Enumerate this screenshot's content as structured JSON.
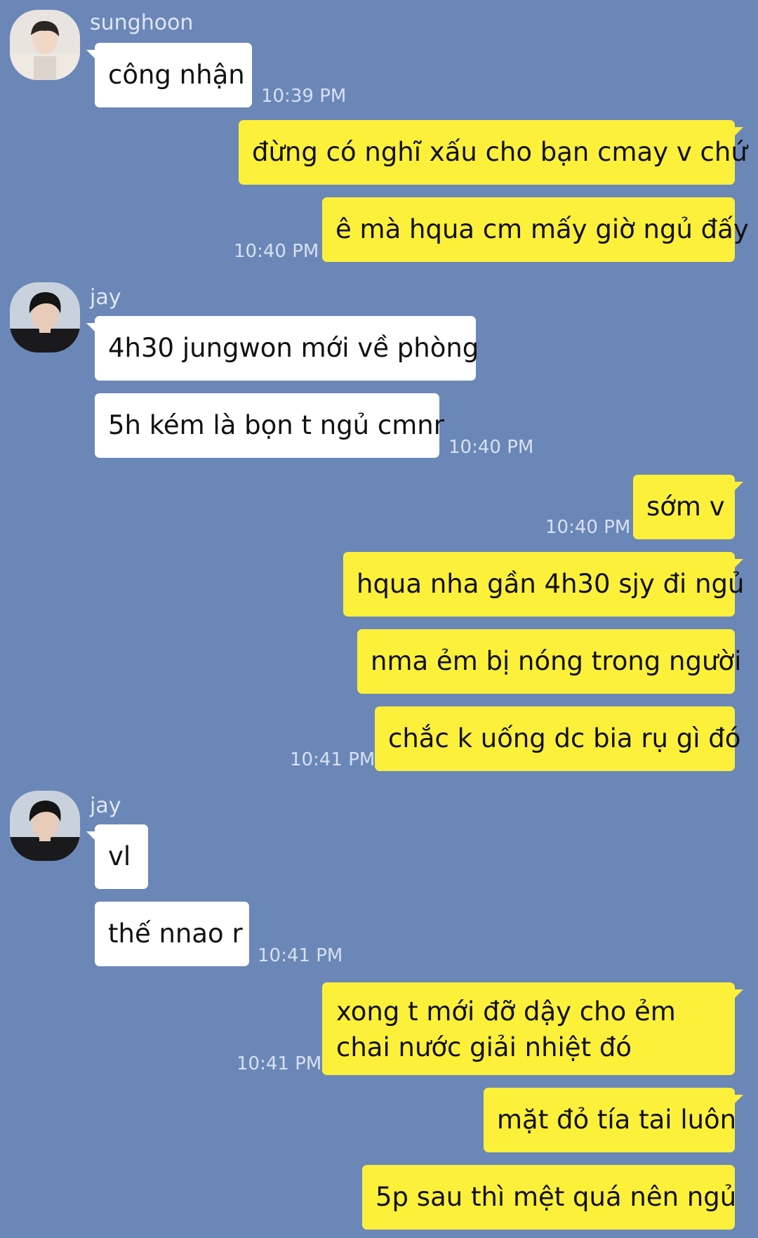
{
  "messages": {
    "m1": {
      "sender": "sunghoon",
      "text": "công nhận",
      "time": "10:39 PM"
    },
    "m2": {
      "text": "đừng có nghĩ xấu cho bạn cmay v chứ"
    },
    "m3": {
      "text": "ê mà hqua cm mấy giờ ngủ đấy",
      "time": "10:40 PM"
    },
    "m4": {
      "sender": "jay",
      "text": "4h30 jungwon mới về phòng"
    },
    "m5": {
      "text": "5h kém là bọn t ngủ cmnr",
      "time": "10:40 PM"
    },
    "m6": {
      "text": "sớm v",
      "time": "10:40 PM"
    },
    "m7": {
      "text": "hqua nha gần 4h30 sjy đi ngủ"
    },
    "m8": {
      "text": "nma ẻm bị nóng trong người"
    },
    "m9": {
      "text": "chắc k uống dc bia rụ gì đó",
      "time": "10:41 PM"
    },
    "m10": {
      "sender": "jay",
      "text": "vl"
    },
    "m11": {
      "text": "thế nnao r",
      "time": "10:41 PM"
    },
    "m12": {
      "text": "xong t mới đỡ dậy cho ẻm chai nước giải nhiệt đó",
      "time": "10:41 PM"
    },
    "m13": {
      "text": "mặt đỏ tía tai luôn"
    },
    "m14": {
      "text": "5p sau thì mệt quá nên ngủ"
    }
  },
  "colors": {
    "background": "#6b87b8",
    "incoming_bubble": "#ffffff",
    "outgoing_bubble": "#fdf03b",
    "meta_text": "#d7e0ee"
  },
  "icons": [
    "sunghoon-avatar",
    "jay-avatar"
  ]
}
